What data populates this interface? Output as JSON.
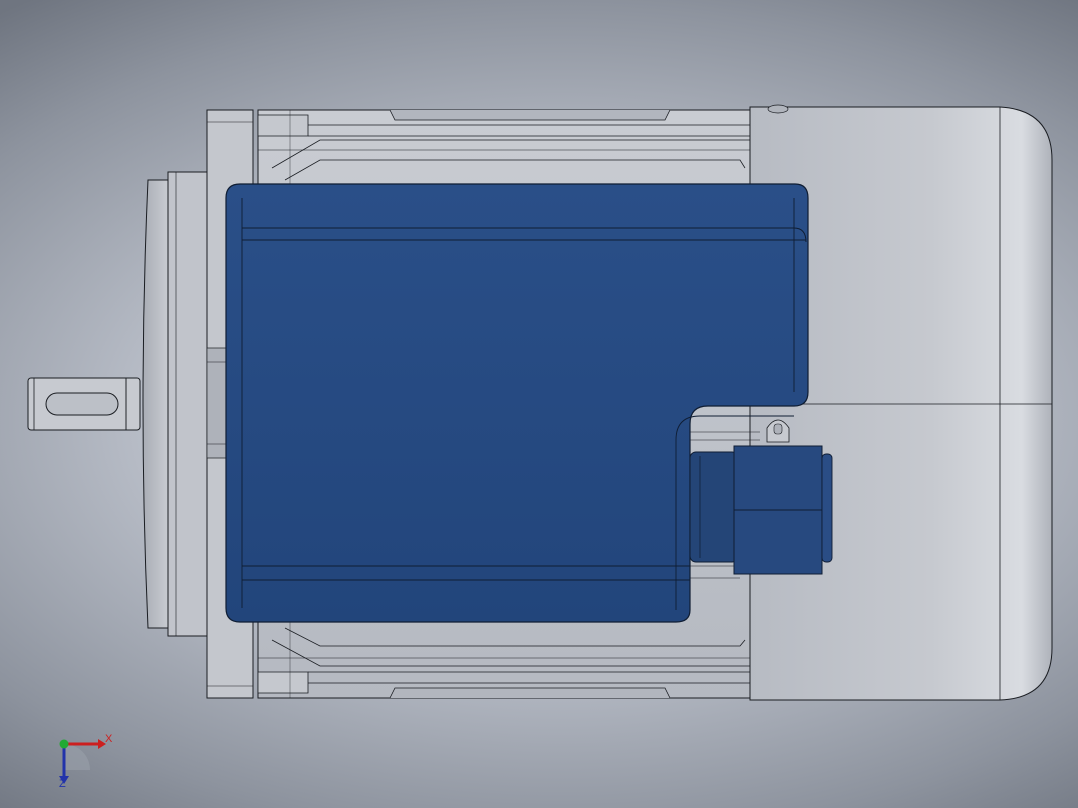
{
  "viewport": {
    "model": "motor-assembly",
    "colors": {
      "background": "#b9bec8",
      "housing": "#c3c6cd",
      "terminal_box": "#25477d",
      "outline": "#1a1d22"
    }
  },
  "triad": {
    "x_label": "X",
    "z_label": "Z",
    "icons": [
      "x-axis-arrow",
      "y-axis-dot",
      "z-axis-arrow"
    ]
  }
}
